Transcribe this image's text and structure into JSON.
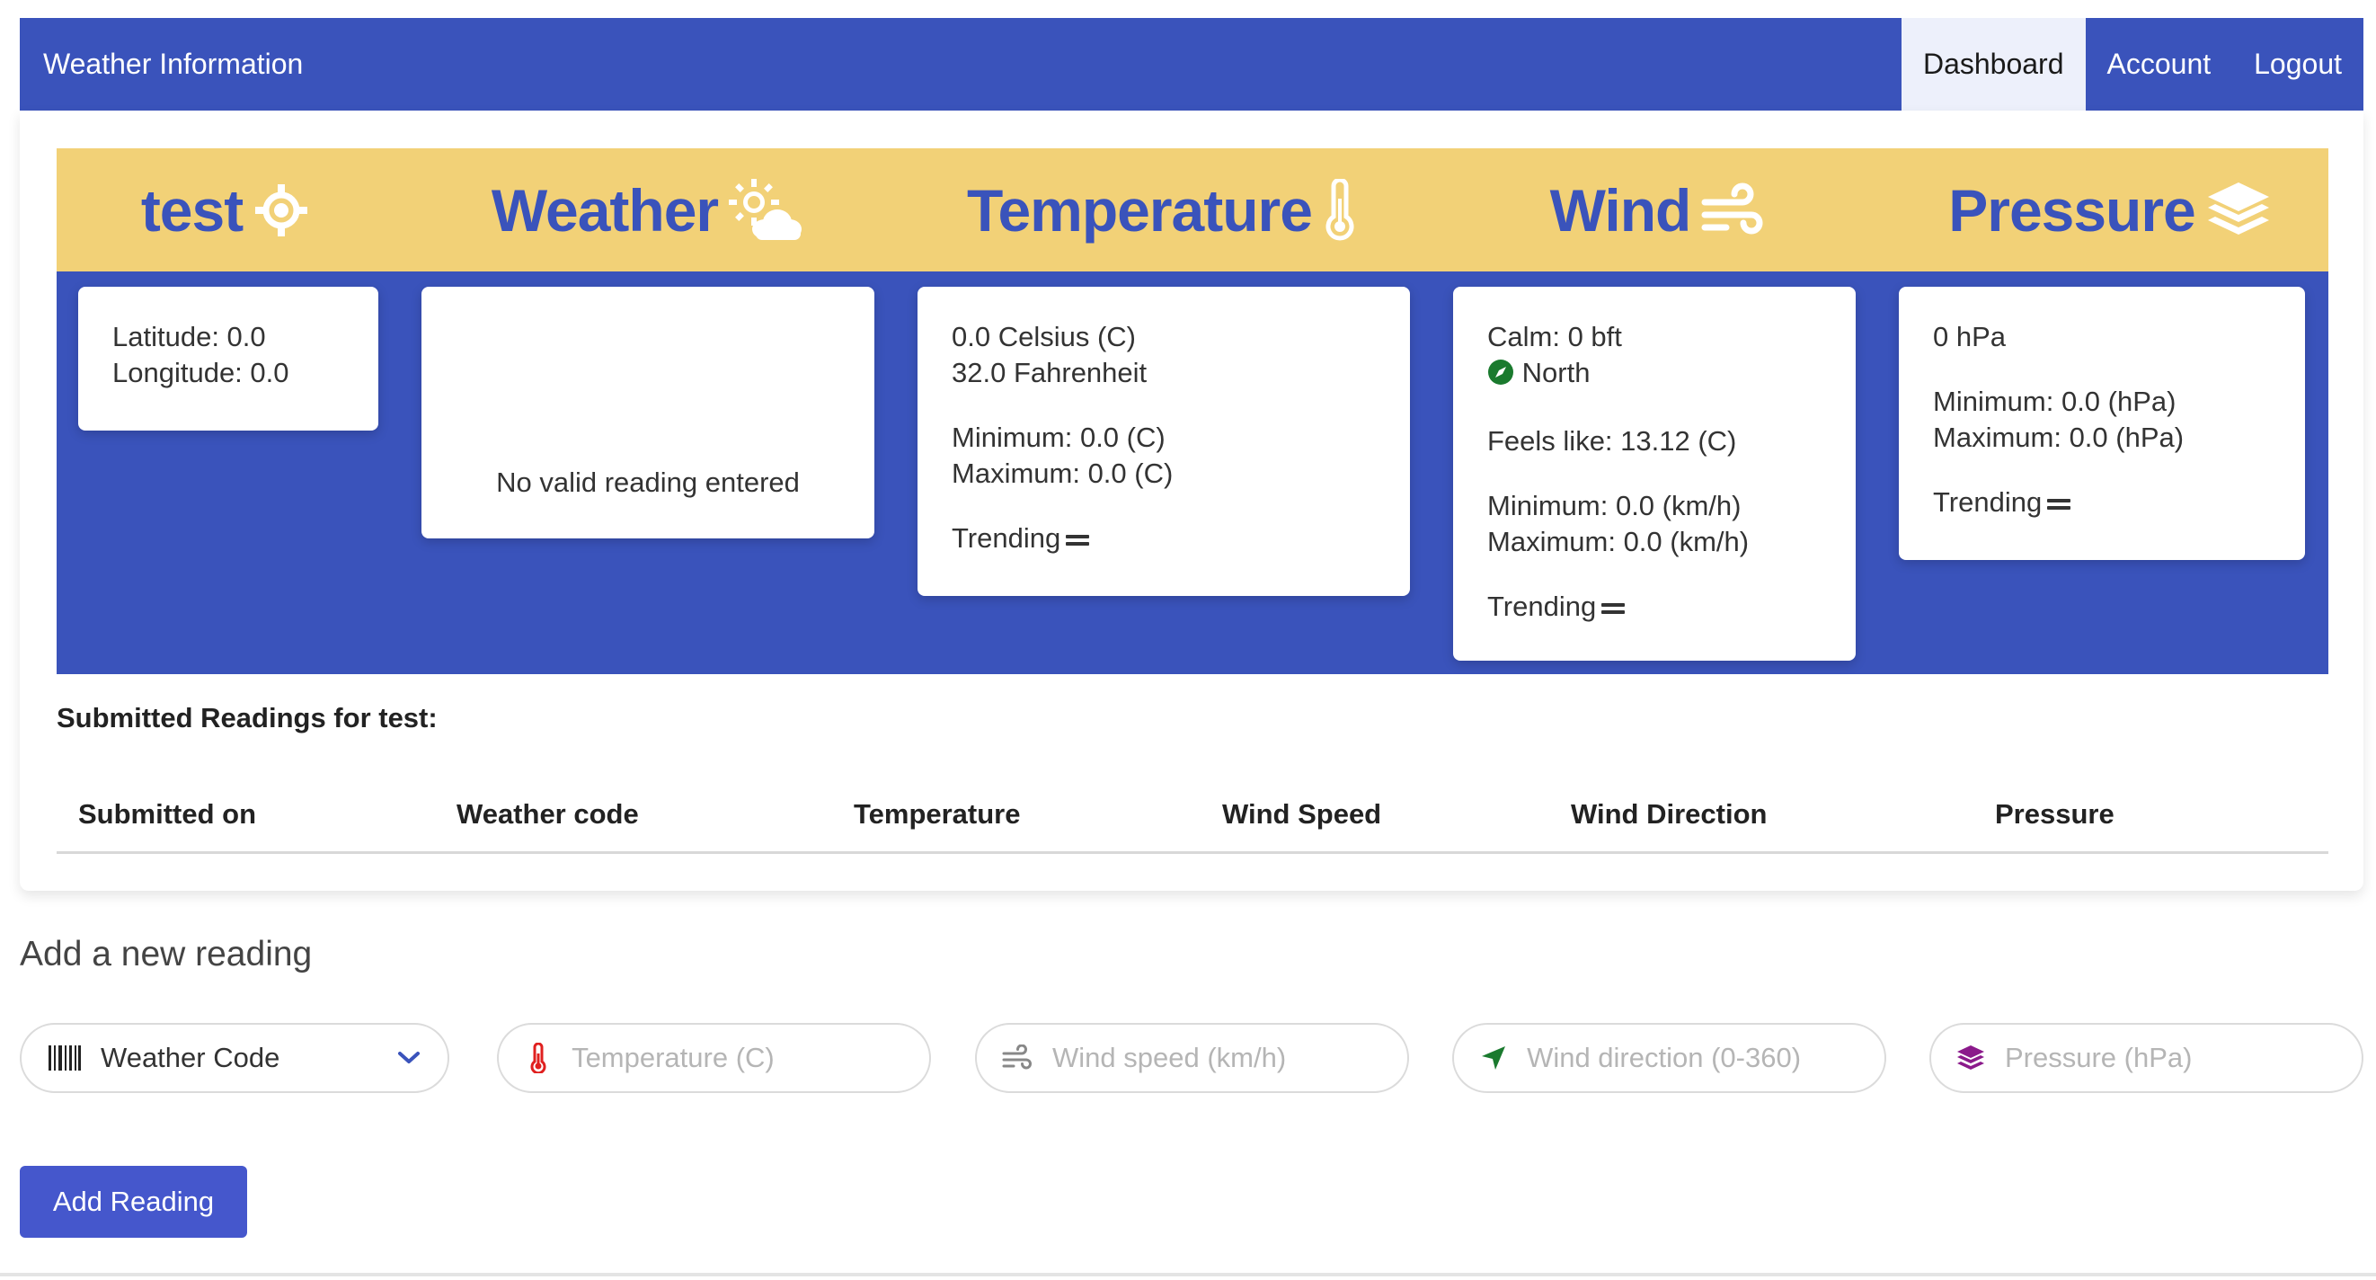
{
  "navbar": {
    "brand": "Weather Information",
    "items": [
      {
        "label": "Dashboard",
        "active": true
      },
      {
        "label": "Account",
        "active": false
      },
      {
        "label": "Logout",
        "active": false
      }
    ]
  },
  "columns": {
    "station": {
      "title": "test",
      "icon": "crosshair-icon"
    },
    "weather": {
      "title": "Weather",
      "icon": "sun-cloud-icon"
    },
    "temperature": {
      "title": "Temperature",
      "icon": "thermometer-icon"
    },
    "wind": {
      "title": "Wind",
      "icon": "wind-icon"
    },
    "pressure": {
      "title": "Pressure",
      "icon": "layers-icon"
    }
  },
  "cards": {
    "station": {
      "latitude": "Latitude: 0.0",
      "longitude": "Longitude: 0.0"
    },
    "weather": {
      "message": "No valid reading entered"
    },
    "temperature": {
      "celsius": "0.0 Celsius (C)",
      "fahrenheit": "32.0 Fahrenheit",
      "minimum": "Minimum: 0.0 (C)",
      "maximum": "Maximum: 0.0 (C)",
      "trending": "Trending"
    },
    "wind": {
      "calm": "Calm: 0 bft",
      "direction": "North",
      "feels_like": "Feels like: 13.12 (C)",
      "minimum": "Minimum: 0.0 (km/h)",
      "maximum": "Maximum: 0.0 (km/h)",
      "trending": "Trending"
    },
    "pressure": {
      "value": "0 hPa",
      "minimum": "Minimum: 0.0 (hPa)",
      "maximum": "Maximum: 0.0 (hPa)",
      "trending": "Trending"
    }
  },
  "readings": {
    "title": "Submitted Readings for test:",
    "columns": [
      "Submitted on",
      "Weather code",
      "Temperature",
      "Wind Speed",
      "Wind Direction",
      "Pressure"
    ]
  },
  "form": {
    "title": "Add a new reading",
    "weather_code_label": "Weather Code",
    "temperature_placeholder": "Temperature (C)",
    "wind_speed_placeholder": "Wind speed (km/h)",
    "wind_direction_placeholder": "Wind direction (0-360)",
    "pressure_placeholder": "Pressure (hPa)",
    "submit_label": "Add Reading"
  },
  "colors": {
    "primary": "#3a53bb",
    "header_band": "#f2d177",
    "compass": "#1a7a2e",
    "thermometer_red": "#e0201f",
    "direction_green": "#1a7a2e",
    "pressure_purple": "#8b1a8b"
  }
}
